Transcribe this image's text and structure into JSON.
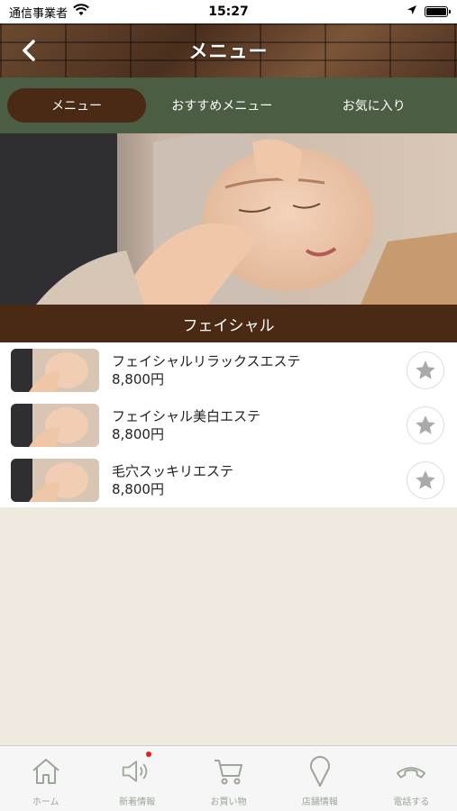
{
  "status_bar": {
    "carrier": "通信事業者",
    "time": "15:27"
  },
  "header": {
    "title": "メニュー",
    "back_icon": "chevron-left-icon"
  },
  "tabs": [
    {
      "label": "メニュー",
      "active": true
    },
    {
      "label": "おすすめメニュー",
      "active": false
    },
    {
      "label": "お気に入り",
      "active": false
    }
  ],
  "category": {
    "title": "フェイシャル"
  },
  "menu_items": [
    {
      "name": "フェイシャルリラックスエステ",
      "price": "8,800円",
      "favorite": false
    },
    {
      "name": "フェイシャル美白エステ",
      "price": "8,800円",
      "favorite": false
    },
    {
      "name": "毛穴スッキリエステ",
      "price": "8,800円",
      "favorite": false
    }
  ],
  "bottom_nav": [
    {
      "label": "ホーム",
      "icon": "home-icon"
    },
    {
      "label": "新着情報",
      "icon": "speaker-icon",
      "badge": true
    },
    {
      "label": "お買い物",
      "icon": "cart-icon"
    },
    {
      "label": "店舗情報",
      "icon": "map-pin-icon"
    },
    {
      "label": "電話する",
      "icon": "phone-icon"
    }
  ],
  "colors": {
    "tab_bar": "#4b5e44",
    "accent_brown": "#4a2a14",
    "background": "#efe9df",
    "nav_icon": "#9aa797",
    "badge": "#e0201c"
  }
}
